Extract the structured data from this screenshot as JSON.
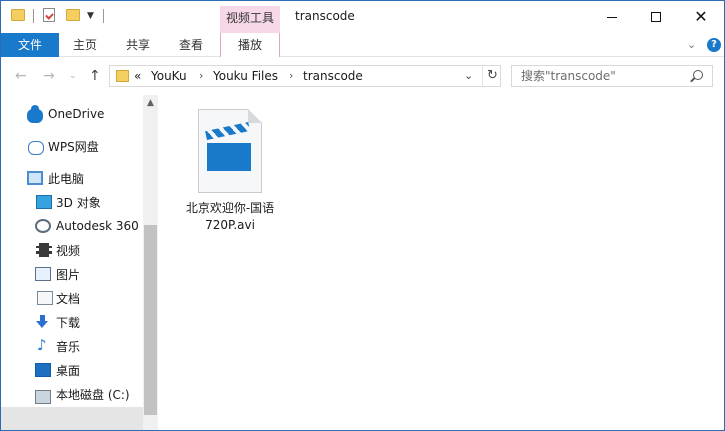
{
  "window": {
    "title": "transcode",
    "contextual_tab_group": "视频工具"
  },
  "ribbon": {
    "file_tab": "文件",
    "tabs": [
      "主页",
      "共享",
      "查看"
    ],
    "contextual_tab": "播放"
  },
  "address": {
    "overflow": "«",
    "crumbs": [
      "YouKu",
      "Youku Files",
      "transcode"
    ],
    "separator": "›"
  },
  "search": {
    "placeholder": "搜索\"transcode\""
  },
  "nav_pane": {
    "items": [
      {
        "label": "OneDrive",
        "icon": "onedrive-cloud-icon"
      },
      {
        "label": "WPS网盘",
        "icon": "wps-cloud-icon"
      },
      {
        "label": "此电脑",
        "icon": "this-pc-icon"
      },
      {
        "label": "3D 对象",
        "icon": "3d-objects-icon"
      },
      {
        "label": "Autodesk 360",
        "icon": "autodesk-360-icon"
      },
      {
        "label": "视频",
        "icon": "videos-icon"
      },
      {
        "label": "图片",
        "icon": "pictures-icon"
      },
      {
        "label": "文档",
        "icon": "documents-icon"
      },
      {
        "label": "下载",
        "icon": "downloads-icon"
      },
      {
        "label": "音乐",
        "icon": "music-icon"
      },
      {
        "label": "桌面",
        "icon": "desktop-icon"
      },
      {
        "label": "本地磁盘 (C:)",
        "icon": "local-disk-icon"
      }
    ]
  },
  "content": {
    "files": [
      {
        "name_line1": "北京欢迎你-国语",
        "name_line2": "720P.avi",
        "icon": "video-file-icon"
      }
    ]
  },
  "colors": {
    "accent": "#1979ca",
    "contextual_tab": "#f7d8e8",
    "folder": "#f4cf5f"
  }
}
